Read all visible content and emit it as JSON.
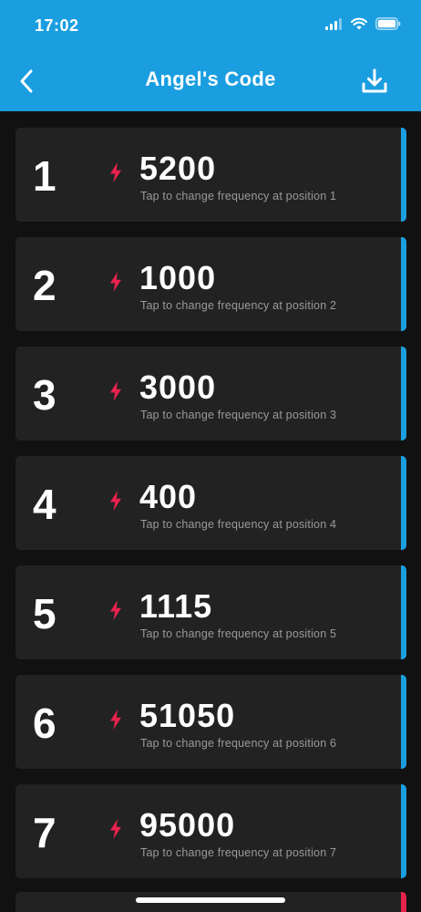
{
  "status_bar": {
    "time": "17:02"
  },
  "header": {
    "title": "Angel's Code",
    "back_icon": "chevron-left-icon",
    "download_icon": "download-icon"
  },
  "colors": {
    "header_bg": "#1a9ee0",
    "background": "#111111",
    "card_bg": "#222222",
    "accent_blue": "#1a9ee0",
    "accent_red": "#e8234e",
    "bolt": "#e8234e"
  },
  "items": [
    {
      "position": "1",
      "frequency": "5200",
      "hint": "Tap to change frequency at position 1"
    },
    {
      "position": "2",
      "frequency": "1000",
      "hint": "Tap to change frequency at position 2"
    },
    {
      "position": "3",
      "frequency": "3000",
      "hint": "Tap to change frequency at position 3"
    },
    {
      "position": "4",
      "frequency": "400",
      "hint": "Tap to change frequency at position 4"
    },
    {
      "position": "5",
      "frequency": "1115",
      "hint": "Tap to change frequency at position 5"
    },
    {
      "position": "6",
      "frequency": "51050",
      "hint": "Tap to change frequency at position 6"
    },
    {
      "position": "7",
      "frequency": "95000",
      "hint": "Tap to change frequency at position 7"
    }
  ]
}
